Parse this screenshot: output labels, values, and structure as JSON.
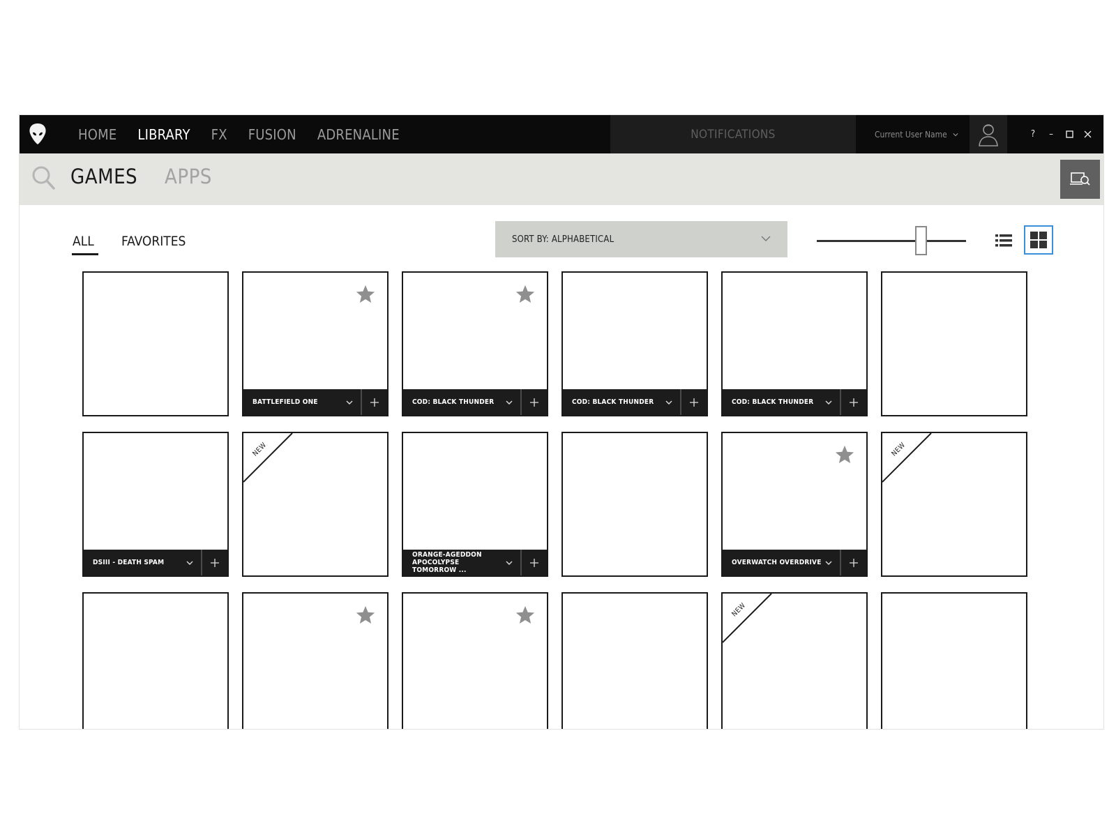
{
  "nav": {
    "items": [
      {
        "label": "HOME",
        "active": false
      },
      {
        "label": "LIBRARY",
        "active": true
      },
      {
        "label": "FX",
        "active": false
      },
      {
        "label": "FUSION",
        "active": false
      },
      {
        "label": "ADRENALINE",
        "active": false
      }
    ],
    "notifications_label": "NOTIFICATIONS",
    "user_name": "Current User Name",
    "window_controls": [
      "?",
      "–",
      "□",
      "✕"
    ]
  },
  "subbar": {
    "tabs": [
      {
        "label": "GAMES",
        "active": true
      },
      {
        "label": "APPS",
        "active": false
      }
    ]
  },
  "filters": {
    "all_label": "ALL",
    "favorites_label": "FAVORITES",
    "sort_label": "SORT BY: ALPHABETICAL",
    "size_slider_value": 0.7,
    "view_mode": "grid"
  },
  "tiles": [
    {
      "name": "",
      "favorite": false,
      "new": false
    },
    {
      "name": "BATTLEFIELD ONE",
      "favorite": true,
      "new": false
    },
    {
      "name": "COD: BLACK THUNDER",
      "favorite": true,
      "new": false
    },
    {
      "name": "COD: BLACK THUNDER",
      "favorite": false,
      "new": false
    },
    {
      "name": "COD: BLACK THUNDER",
      "favorite": false,
      "new": false
    },
    {
      "name": "",
      "favorite": false,
      "new": false
    },
    {
      "name": "DSIII - DEATH SPAM",
      "favorite": false,
      "new": false
    },
    {
      "name": "",
      "favorite": false,
      "new": true
    },
    {
      "name_lines": [
        "ORANGE-AGEDDON",
        "APOCOLYPSE TOMORROW ..."
      ],
      "favorite": false,
      "new": false
    },
    {
      "name": "",
      "favorite": false,
      "new": false
    },
    {
      "name": "OVERWATCH OVERDRIVE",
      "favorite": true,
      "new": false
    },
    {
      "name": "",
      "favorite": false,
      "new": true
    },
    {
      "name": "",
      "favorite": false,
      "new": false
    },
    {
      "name": "",
      "favorite": true,
      "new": false
    },
    {
      "name": "",
      "favorite": true,
      "new": false
    },
    {
      "name": "",
      "favorite": false,
      "new": false
    },
    {
      "name": "",
      "favorite": false,
      "new": true
    },
    {
      "name": "",
      "favorite": false,
      "new": false
    }
  ],
  "new_badge_label": "NEW"
}
